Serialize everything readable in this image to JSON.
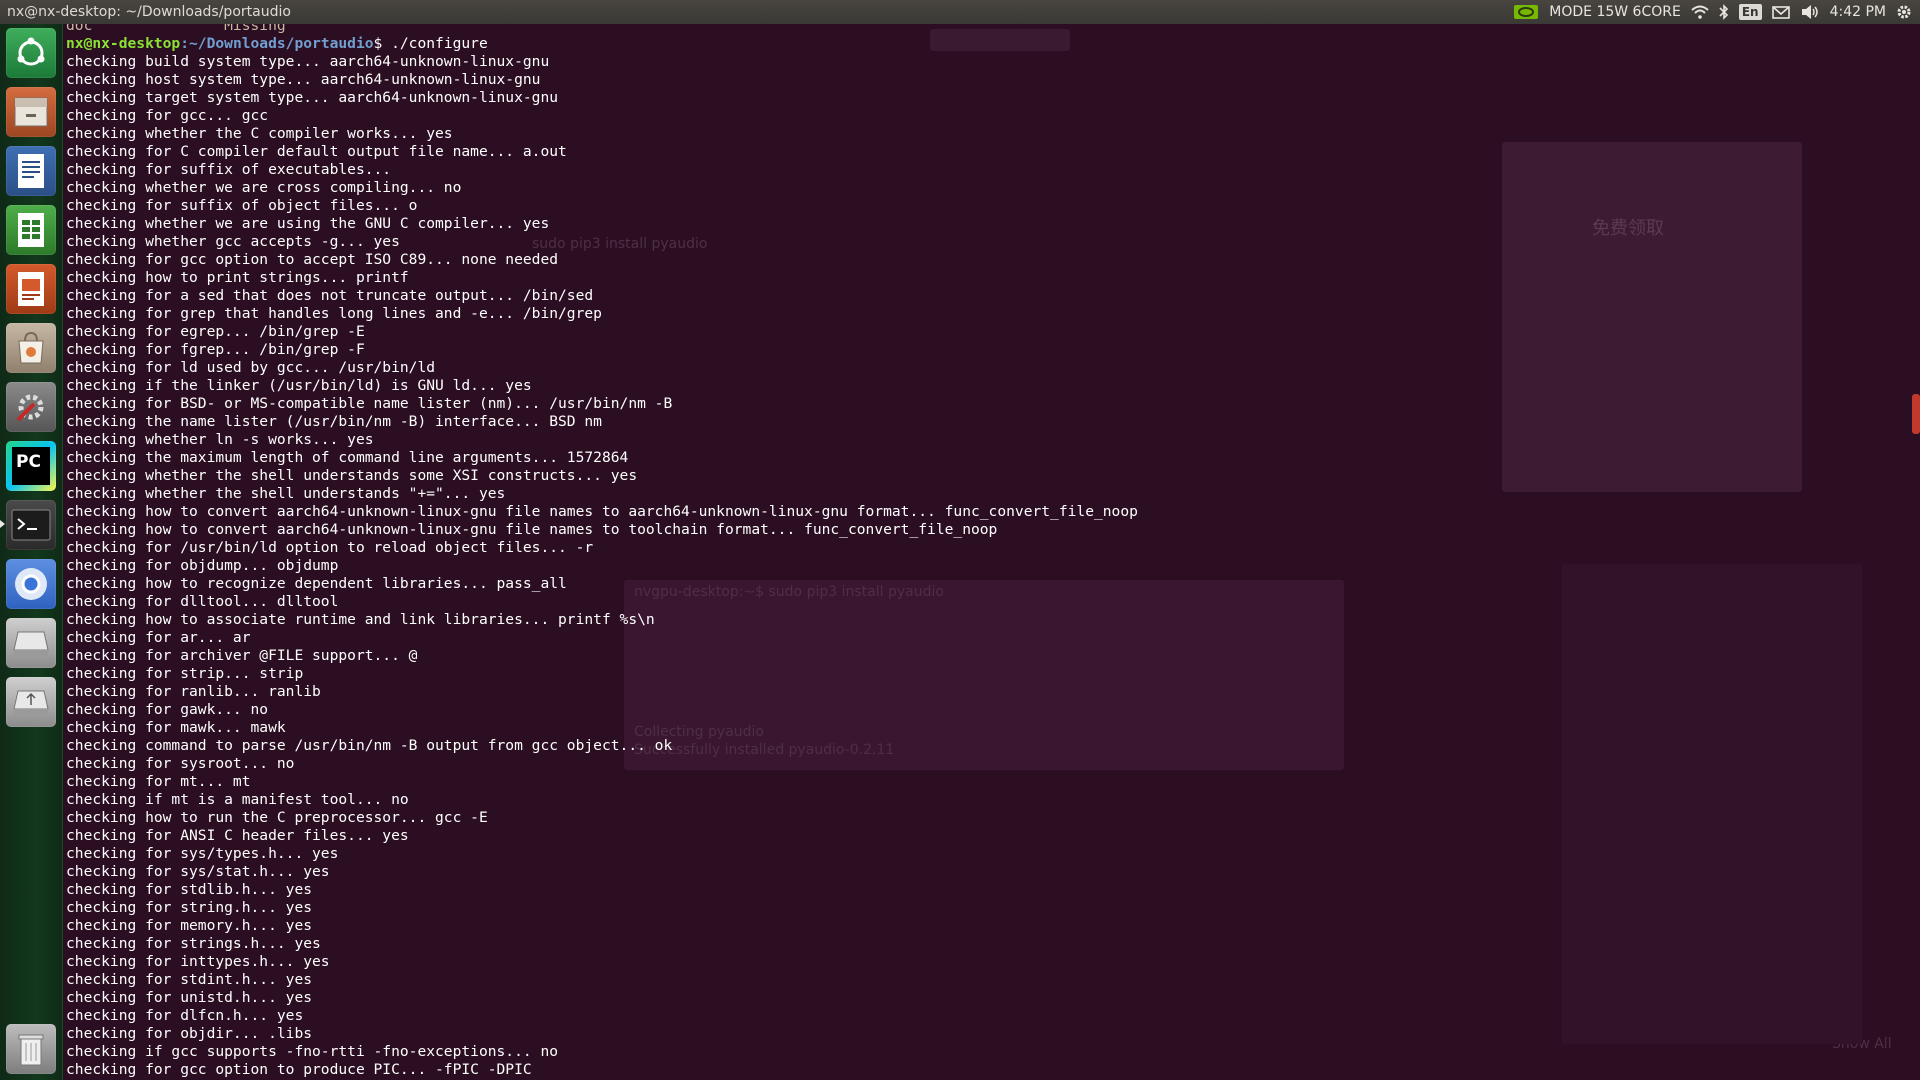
{
  "panel": {
    "window_title": "nx@nx-desktop: ~/Downloads/portaudio",
    "power_mode": "MODE 15W 6CORE",
    "keyboard_layout": "En",
    "clock": "4:42 PM",
    "icons": [
      "nvidia-icon",
      "wifi-icon",
      "bluetooth-icon",
      "keyboard-icon",
      "mail-icon",
      "volume-icon",
      "settings-gear-icon"
    ]
  },
  "launcher": {
    "items": [
      "dash-home",
      "files",
      "writer",
      "calc",
      "impress",
      "software-center",
      "system-settings",
      "pycharm",
      "terminal",
      "chromium",
      "drive",
      "usb-drive",
      "trash"
    ]
  },
  "terminal": {
    "partial_top": "doc               Missing",
    "prompt_user": "nx@nx-desktop",
    "prompt_path": ":~/Downloads/portaudio",
    "prompt_symbol": "$ ",
    "command": "./configure",
    "lines": [
      "checking build system type... aarch64-unknown-linux-gnu",
      "checking host system type... aarch64-unknown-linux-gnu",
      "checking target system type... aarch64-unknown-linux-gnu",
      "checking for gcc... gcc",
      "checking whether the C compiler works... yes",
      "checking for C compiler default output file name... a.out",
      "checking for suffix of executables...",
      "checking whether we are cross compiling... no",
      "checking for suffix of object files... o",
      "checking whether we are using the GNU C compiler... yes",
      "checking whether gcc accepts -g... yes",
      "checking for gcc option to accept ISO C89... none needed",
      "checking how to print strings... printf",
      "checking for a sed that does not truncate output... /bin/sed",
      "checking for grep that handles long lines and -e... /bin/grep",
      "checking for egrep... /bin/grep -E",
      "checking for fgrep... /bin/grep -F",
      "checking for ld used by gcc... /usr/bin/ld",
      "checking if the linker (/usr/bin/ld) is GNU ld... yes",
      "checking for BSD- or MS-compatible name lister (nm)... /usr/bin/nm -B",
      "checking the name lister (/usr/bin/nm -B) interface... BSD nm",
      "checking whether ln -s works... yes",
      "checking the maximum length of command line arguments... 1572864",
      "checking whether the shell understands some XSI constructs... yes",
      "checking whether the shell understands \"+=\"... yes",
      "checking how to convert aarch64-unknown-linux-gnu file names to aarch64-unknown-linux-gnu format... func_convert_file_noop",
      "checking how to convert aarch64-unknown-linux-gnu file names to toolchain format... func_convert_file_noop",
      "checking for /usr/bin/ld option to reload object files... -r",
      "checking for objdump... objdump",
      "checking how to recognize dependent libraries... pass_all",
      "checking for dlltool... dlltool",
      "checking how to associate runtime and link libraries... printf %s\\n",
      "checking for ar... ar",
      "checking for archiver @FILE support... @",
      "checking for strip... strip",
      "checking for ranlib... ranlib",
      "checking for gawk... no",
      "checking for mawk... mawk",
      "checking command to parse /usr/bin/nm -B output from gcc object... ok",
      "checking for sysroot... no",
      "checking for mt... mt",
      "checking if mt is a manifest tool... no",
      "checking how to run the C preprocessor... gcc -E",
      "checking for ANSI C header files... yes",
      "checking for sys/types.h... yes",
      "checking for sys/stat.h... yes",
      "checking for stdlib.h... yes",
      "checking for string.h... yes",
      "checking for memory.h... yes",
      "checking for strings.h... yes",
      "checking for inttypes.h... yes",
      "checking for stdint.h... yes",
      "checking for unistd.h... yes",
      "checking for dlfcn.h... yes",
      "checking for objdir... .libs",
      "checking if gcc supports -fno-rtti -fno-exceptions... no",
      "checking for gcc option to produce PIC... -fPIC -DPIC"
    ]
  },
  "background_window": {
    "tab_label": "sudo pip3 install pyaudio",
    "snippet_lines": [
      "sudo pip3 install pyaudio",
      "nvgpu-desktop:~$ sudo pip3 install pyaudio",
      "Collecting pyaudio",
      "Successfully installed pyaudio-0.2.11"
    ],
    "sidebar_button": "免费领取",
    "show_all": "Show All"
  },
  "colors": {
    "terminal_bg": "#2c0f24",
    "prompt_user": "#8ae234",
    "prompt_path": "#729fcf",
    "panel_bg": "#3b3935",
    "launcher_bg": "#12381d"
  }
}
